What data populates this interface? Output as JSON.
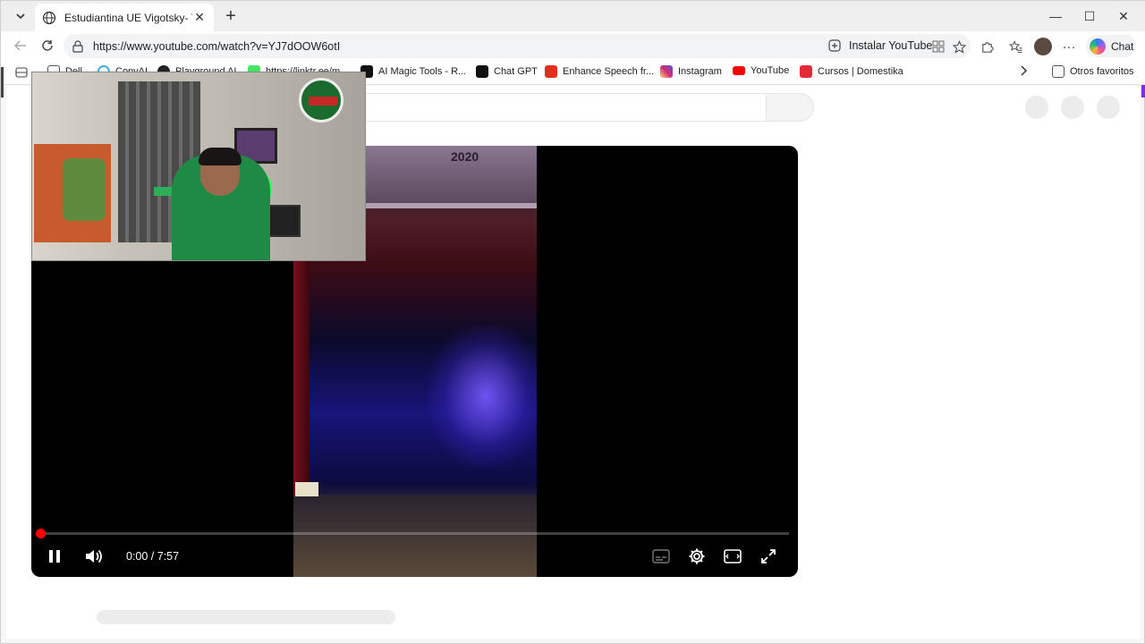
{
  "browser": {
    "tab": {
      "title": "Estudiantina UE Vigotsky- Teatro D",
      "close_label": "✕"
    },
    "new_tab_label": "+",
    "window_controls": {
      "minimize": "—",
      "maximize": "☐",
      "close": "✕"
    },
    "address": {
      "url": "https://www.youtube.com/watch?v=YJ7dOOW6otI"
    },
    "install_app_label": "Instalar YouTube",
    "chat_label": "Chat",
    "more_label": "···"
  },
  "bookmarks": {
    "items": [
      {
        "label": "Dell",
        "icon": "folder-icon",
        "color": "#555555"
      },
      {
        "label": "CopyAI",
        "icon": "copyai-icon",
        "color": "#3fb0d8"
      },
      {
        "label": "Playground AI",
        "icon": "playground-icon",
        "color": "#222222"
      },
      {
        "label": "https://linktr.ee/m...",
        "icon": "linktree-icon",
        "color": "#43e660"
      },
      {
        "label": "AI Magic Tools - R...",
        "icon": "runway-icon",
        "color": "#111111"
      },
      {
        "label": "Chat GPT",
        "icon": "chatgpt-icon",
        "color": "#111111"
      },
      {
        "label": "Enhance Speech fr...",
        "icon": "adobe-icon",
        "color": "#e0301e"
      },
      {
        "label": "Instagram",
        "icon": "instagram-icon",
        "color": "#d62976"
      },
      {
        "label": "YouTube",
        "icon": "youtube-icon",
        "color": "#ff0000"
      },
      {
        "label": "Cursos | Domestika",
        "icon": "domestika-icon",
        "color": "#e52a3a"
      }
    ],
    "other_favorites_label": "Otros favoritos"
  },
  "player": {
    "time_display": "0:00 / 7:57",
    "progress_fraction": 0.0,
    "overlay_year": "2020",
    "accent": "#ff0000"
  }
}
